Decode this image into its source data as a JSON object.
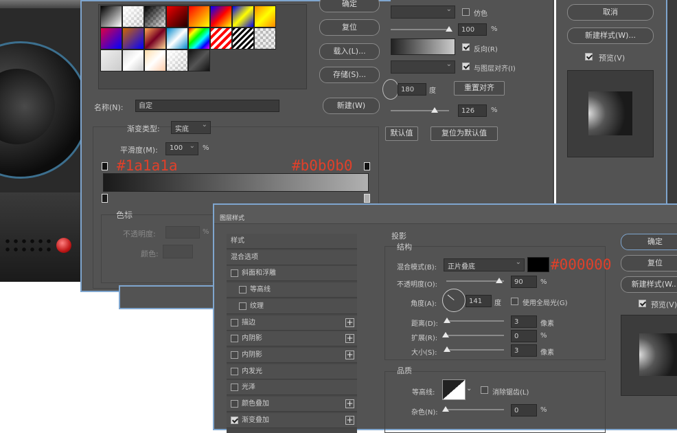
{
  "gradient_editor": {
    "buttons": {
      "ok": "确定",
      "reset": "复位",
      "load": "载入(L)...",
      "save": "存储(S)...",
      "new": "新建(W)"
    },
    "name_label": "名称(N):",
    "name_value": "自定",
    "type_label": "渐变类型:",
    "type_value": "实底",
    "smooth_label": "平滑度(M):",
    "smooth_value": "100",
    "smooth_unit": "%",
    "left_color": "#1a1a1a",
    "right_color": "#b0b0b0",
    "stops_title": "色标",
    "opacity_label": "不透明度:",
    "opacity_unit": "%",
    "color_label": "颜色:"
  },
  "middle_panel": {
    "dither": "仿色",
    "pct1": "100",
    "pct1_unit": "%",
    "reverse": "反向(R)",
    "align": "与图层对齐(I)",
    "angle": "180",
    "angle_unit": "度",
    "reset_align": "重置对齐",
    "pct2": "126",
    "pct2_unit": "%",
    "default_btn": "默认值",
    "reset_default_btn": "复位为默认值"
  },
  "top_right_panel": {
    "cancel": "取消",
    "new_style": "新建样式(W)...",
    "preview": "预览(V)"
  },
  "layer_style": {
    "title": "图层样式",
    "sidebar": [
      {
        "label": "样式",
        "check": false,
        "plus": false,
        "indent": 0,
        "nocheck": true
      },
      {
        "label": "混合选项",
        "check": false,
        "plus": false,
        "indent": 0,
        "nocheck": true
      },
      {
        "label": "斜面和浮雕",
        "check": false,
        "plus": false,
        "indent": 0
      },
      {
        "label": "等高线",
        "check": false,
        "plus": false,
        "indent": 1
      },
      {
        "label": "纹理",
        "check": false,
        "plus": false,
        "indent": 1
      },
      {
        "label": "描边",
        "check": false,
        "plus": true,
        "indent": 0
      },
      {
        "label": "内阴影",
        "check": false,
        "plus": true,
        "indent": 0
      },
      {
        "label": "内阴影",
        "check": false,
        "plus": true,
        "indent": 0
      },
      {
        "label": "内发光",
        "check": false,
        "plus": false,
        "indent": 0
      },
      {
        "label": "光泽",
        "check": false,
        "plus": false,
        "indent": 0
      },
      {
        "label": "颜色叠加",
        "check": false,
        "plus": true,
        "indent": 0
      },
      {
        "label": "渐变叠加",
        "check": true,
        "plus": true,
        "indent": 0
      }
    ],
    "section": "投影",
    "structure": "结构",
    "blend_label": "混合模式(B):",
    "blend_value": "正片叠底",
    "shadow_color": "#000000",
    "opacity_label": "不透明度(O):",
    "opacity_value": "90",
    "opacity_unit": "%",
    "angle_label": "角度(A):",
    "angle_value": "141",
    "angle_unit": "度",
    "global_light": "使用全局光(G)",
    "distance_label": "距离(D):",
    "distance_value": "3",
    "distance_unit": "像素",
    "spread_label": "扩展(R):",
    "spread_value": "0",
    "spread_unit": "%",
    "size_label": "大小(S):",
    "size_value": "3",
    "size_unit": "像素",
    "quality": "品质",
    "contour_label": "等高线:",
    "antialias": "消除锯齿(L)",
    "noise_label": "杂色(N):",
    "noise_value": "0",
    "noise_unit": "%",
    "ok": "确定",
    "reset": "复位",
    "new_style": "新建样式(W...",
    "preview": "预览(V)"
  }
}
